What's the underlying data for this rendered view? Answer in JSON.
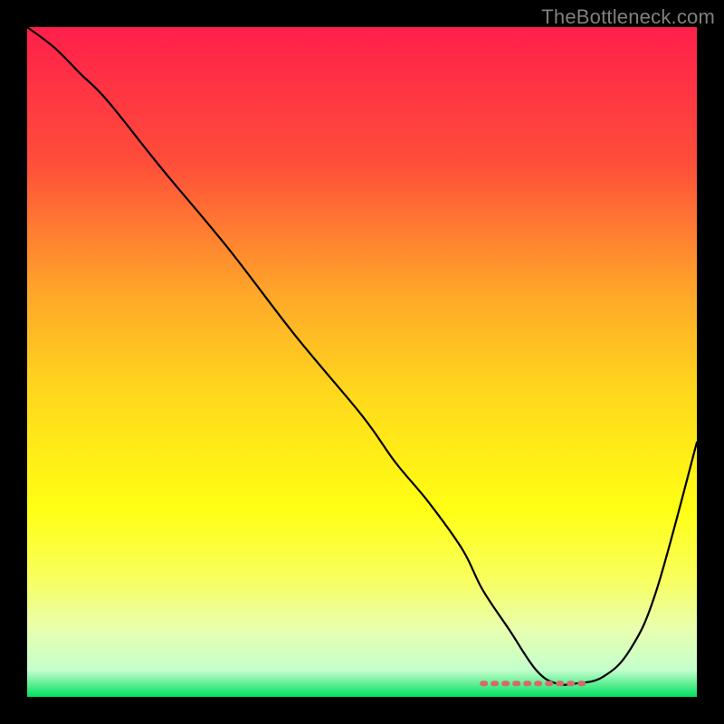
{
  "watermark": {
    "text": "TheBottleneck.com"
  },
  "colors": {
    "background": "#000000",
    "gradient_stops": [
      {
        "offset": 0.0,
        "color": "#ff1f4b"
      },
      {
        "offset": 0.2,
        "color": "#ff4d3a"
      },
      {
        "offset": 0.4,
        "color": "#ffa829"
      },
      {
        "offset": 0.55,
        "color": "#ffd91c"
      },
      {
        "offset": 0.72,
        "color": "#ffff14"
      },
      {
        "offset": 0.82,
        "color": "#f9ff5a"
      },
      {
        "offset": 0.9,
        "color": "#e8ffb0"
      },
      {
        "offset": 0.96,
        "color": "#c4ffcc"
      },
      {
        "offset": 1.0,
        "color": "#00e060"
      }
    ],
    "curve": "#000000",
    "flat_segment": "#d46a6a"
  },
  "chart_data": {
    "type": "line",
    "title": "",
    "xlabel": "",
    "ylabel": "",
    "xlim": [
      0,
      100
    ],
    "ylim": [
      0,
      100
    ],
    "x": [
      0,
      4,
      8,
      12,
      20,
      30,
      40,
      50,
      55,
      60,
      65,
      68,
      72,
      76,
      79,
      82,
      86,
      90,
      94,
      100
    ],
    "values": [
      100,
      97,
      93,
      89,
      79,
      67,
      54,
      42,
      35,
      29,
      22,
      16,
      10,
      4,
      2,
      2,
      3,
      7,
      16,
      38
    ],
    "flat_region": {
      "x_start": 68,
      "x_end": 84,
      "y": 2
    }
  }
}
